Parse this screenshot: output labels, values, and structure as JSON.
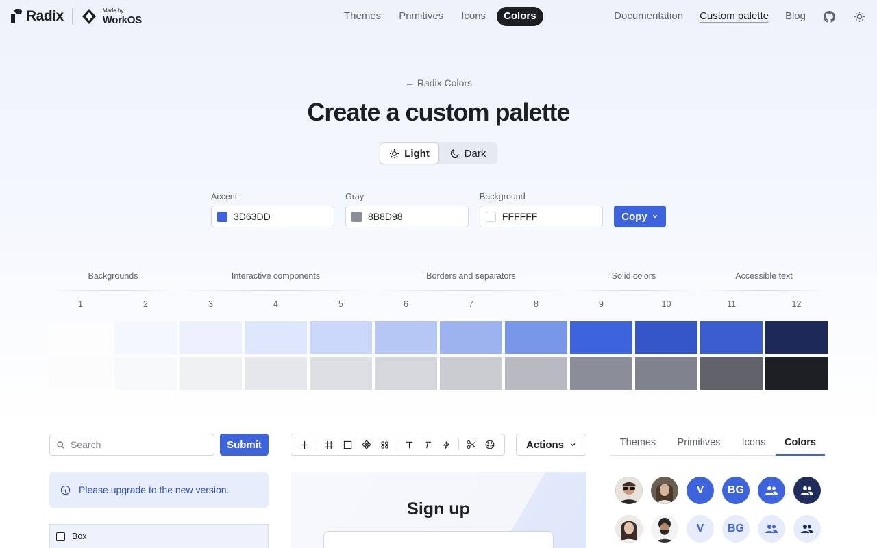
{
  "nav": {
    "brand": "Radix",
    "made_by_small": "Made by",
    "made_by_big": "WorkOS",
    "center_links": [
      "Themes",
      "Primitives",
      "Icons",
      "Colors"
    ],
    "center_active": "Colors",
    "right_links": [
      "Documentation",
      "Custom palette",
      "Blog"
    ],
    "right_current": "Custom palette",
    "icons": [
      "github-icon",
      "sun-icon"
    ]
  },
  "hero": {
    "back_label": "← Radix Colors",
    "title": "Create a custom palette",
    "mode_light": "Light",
    "mode_dark": "Dark",
    "mode_selected": "Light"
  },
  "inputs": {
    "accent_label": "Accent",
    "accent_value": "3D63DD",
    "gray_label": "Gray",
    "gray_value": "8B8D98",
    "background_label": "Background",
    "background_value": "FFFFFF",
    "copy_label": "Copy"
  },
  "scale": {
    "groups": [
      "Backgrounds",
      "Interactive components",
      "Borders and separators",
      "Solid colors",
      "Accessible text"
    ],
    "steps": [
      "1",
      "2",
      "3",
      "4",
      "5",
      "6",
      "7",
      "8",
      "9",
      "10",
      "11",
      "12"
    ],
    "accent_colors": [
      "#fdfdfe",
      "#f4f7fd",
      "#ebf0fc",
      "#dde6fb",
      "#cad7fb",
      "#b6c7f6",
      "#9db3ef",
      "#7896e7",
      "#3d63dd",
      "#3556c6",
      "#3a5ccc",
      "#1c2959"
    ],
    "gray_colors": [
      "#fcfcfd",
      "#f8f9fa",
      "#eff0f2",
      "#e6e7ea",
      "#dedfe3",
      "#d6d7dc",
      "#cbccd2",
      "#b8b9c1",
      "#8b8d98",
      "#80828d",
      "#62636a",
      "#1e1f24"
    ]
  },
  "widgets": {
    "search_placeholder": "Search",
    "submit_label": "Submit",
    "callout_text": "Please upgrade to the new version.",
    "table_first_cell": "Box",
    "actions_label": "Actions",
    "signup_title": "Sign up",
    "tabs": [
      "Themes",
      "Primitives",
      "Icons",
      "Colors"
    ],
    "tab_selected": "Colors",
    "avatar_row1": [
      "photo",
      "photo",
      "V",
      "BG",
      "people-icon",
      "people-icon"
    ],
    "avatar_row2": [
      "photo",
      "photo",
      "V",
      "BG",
      "people-icon",
      "people-icon"
    ]
  },
  "colors": {
    "accent": "#3d63dd",
    "gray": "#8b8d98",
    "text": "#1c2024",
    "muted": "#60646c"
  }
}
